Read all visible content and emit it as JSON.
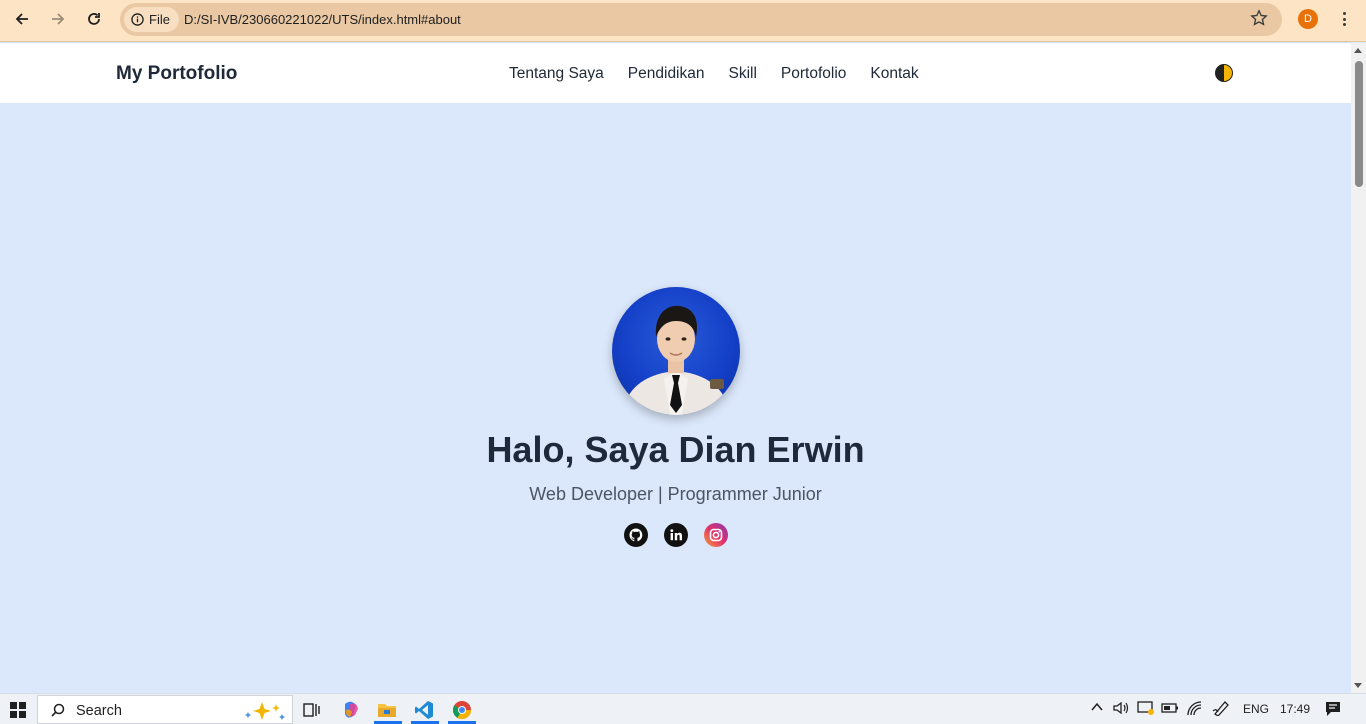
{
  "browser": {
    "site_chip": "File",
    "url": "D:/SI-IVB/230660221022/UTS/index.html#about",
    "profile_initial": "D"
  },
  "header": {
    "brand": "My Portofolio",
    "menu": [
      "Tentang Saya",
      "Pendidikan",
      "Skill",
      "Portofolio",
      "Kontak"
    ]
  },
  "hero": {
    "title": "Halo, Saya Dian Erwin",
    "subtitle": "Web Developer | Programmer Junior",
    "socials": [
      "github-icon",
      "linkedin-icon",
      "instagram-icon"
    ]
  },
  "taskbar": {
    "search_label": "Search",
    "language": "ENG",
    "time": "17:49"
  },
  "colors": {
    "page_bg": "#dbe8fb",
    "chrome_bg": "#fde4c4",
    "title": "#1e293b"
  }
}
